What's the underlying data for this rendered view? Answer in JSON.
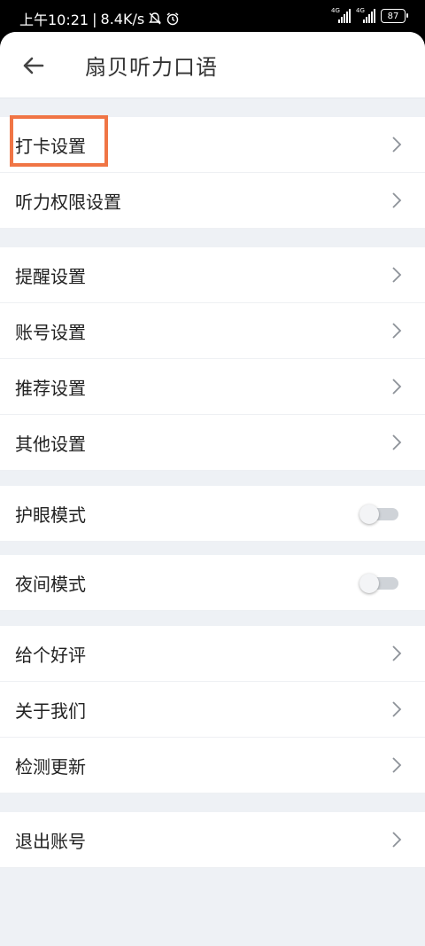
{
  "status_bar": {
    "time": "上午10:21",
    "separator": "|",
    "speed": "8.4K/s",
    "network_tag_1": "4G",
    "network_tag_2": "4G",
    "battery": "87"
  },
  "header": {
    "title": "扇贝听力口语"
  },
  "settings": {
    "clock_in": "打卡设置",
    "listening_permission": "听力权限设置",
    "reminder": "提醒设置",
    "account": "账号设置",
    "recommend": "推荐设置",
    "other": "其他设置",
    "eye_care_mode": "护眼模式",
    "night_mode": "夜间模式",
    "rate_us": "给个好评",
    "about_us": "关于我们",
    "check_update": "检测更新",
    "logout": "退出账号"
  },
  "toggles": {
    "eye_care_on": false,
    "night_mode_on": false
  },
  "colors": {
    "highlight": "#f07545",
    "background": "#eef1f5"
  }
}
